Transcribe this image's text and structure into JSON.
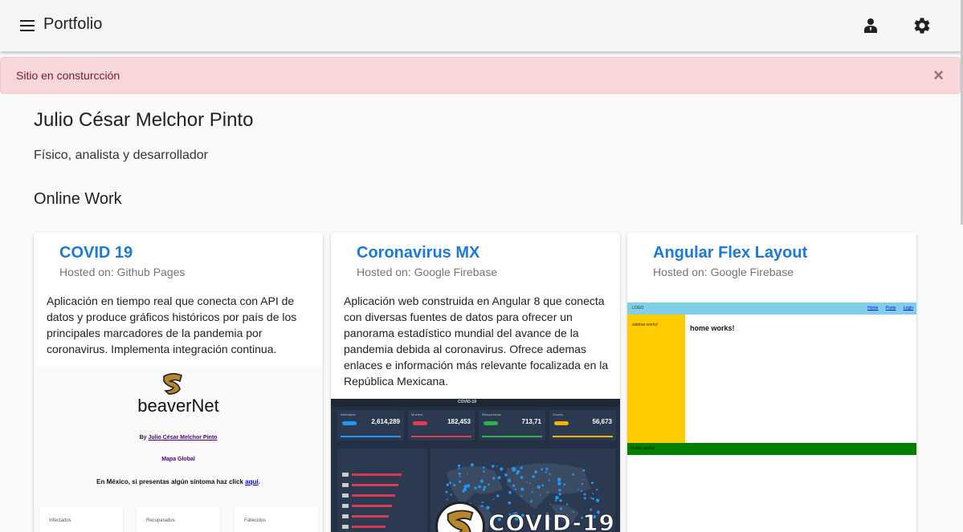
{
  "toolbar": {
    "title": "Portfolio",
    "menu_icon": "menu-icon",
    "account_icon": "account-icon",
    "settings_icon": "gear-icon"
  },
  "alert": {
    "text": "Sitio en consturcción",
    "close": "×"
  },
  "profile": {
    "name": "Julio César Melchor Pinto",
    "subtitle": "Físico, analista y desarrollador"
  },
  "section_title": "Online Work",
  "cards": [
    {
      "title": "COVID 19",
      "hosted": "Hosted on: Github Pages",
      "description": "Aplicación en tiempo real que conecta con API de datos y produce gráficos históricos por país de los principales marcadores de la pandemia por coronavirus. Implementa integración continua.",
      "thumb": {
        "brand": "beaverNet",
        "by_prefix": "By ",
        "by_name": "Julio César Melchor Pinto",
        "map_link": "Mapa Global",
        "mexico_text": "En México, si presentas algún síntoma haz click ",
        "mexico_link": "aquí",
        "stats": [
          "Infectados",
          "Recuperados",
          "Fallecidos"
        ]
      }
    },
    {
      "title": "Coronavirus MX",
      "hosted": "Hosted on: Google Firebase",
      "description": "Aplicación web construida en Angular 8 que conecta con diversas fuentes de datos para ofrecer un panorama estadístico mundial del avance de la pandemia debida al coronavirus. Ofrece ademas enlaces e información más relevante focalizada en la República Mexicana.",
      "thumb": {
        "header": "COVID-19",
        "tiles": [
          {
            "label": "Infectados",
            "value": "2,614,289",
            "color": "#2196f3"
          },
          {
            "label": "Muertes",
            "value": "182,453",
            "color": "#e53950"
          },
          {
            "label": "Recuperados",
            "value": "713,71",
            "color": "#2bb34a"
          },
          {
            "label": "Graves",
            "value": "56,673",
            "color": "#f5b400"
          }
        ],
        "badge_text": "COVID-19"
      }
    },
    {
      "title": "Angular Flex Layout",
      "hosted": "Hosted on: Google Firebase",
      "thumb": {
        "logo": "LOGO",
        "links": [
          "Home",
          "Posts",
          "Login"
        ],
        "sidebar": "sidebar works!",
        "home": "home works!",
        "footer": "Footer works!"
      }
    }
  ]
}
